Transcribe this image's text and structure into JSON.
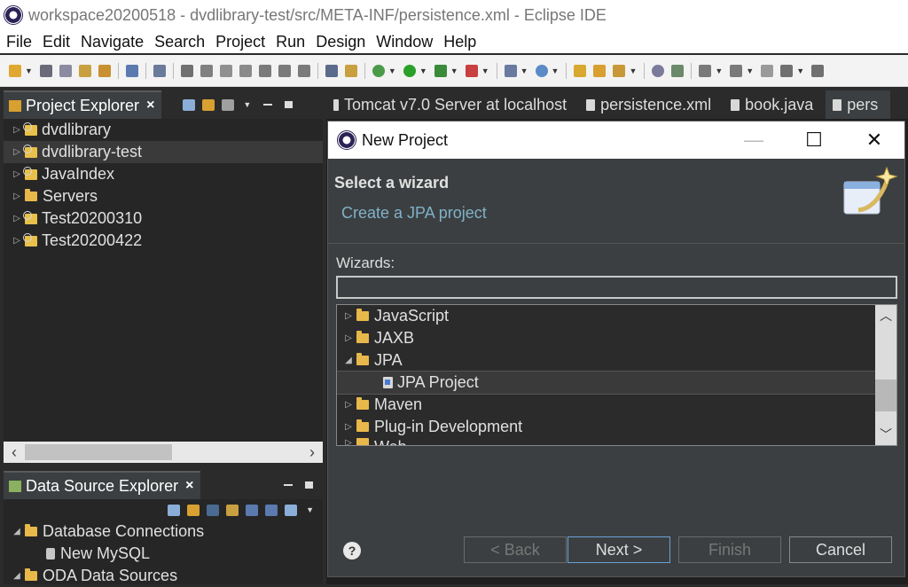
{
  "window": {
    "title": "workspace20200518 - dvdlibrary-test/src/META-INF/persistence.xml - Eclipse IDE",
    "icon": "eclipse-icon"
  },
  "menu": [
    "File",
    "Edit",
    "Navigate",
    "Search",
    "Project",
    "Run",
    "Design",
    "Window",
    "Help"
  ],
  "project_explorer": {
    "title": "Project Explorer",
    "close": "×",
    "items": [
      {
        "label": "dvdlibrary",
        "icon": "project-icon"
      },
      {
        "label": "dvdlibrary-test",
        "icon": "project-icon",
        "selected": true
      },
      {
        "label": "JavaIndex",
        "icon": "project-icon"
      },
      {
        "label": "Servers",
        "icon": "folder-icon"
      },
      {
        "label": "Test20200310",
        "icon": "project-icon"
      },
      {
        "label": "Test20200422",
        "icon": "project-icon"
      }
    ]
  },
  "data_source_explorer": {
    "title": "Data Source Explorer",
    "close": "×",
    "items": [
      {
        "label": "Database Connections",
        "expanded": true
      },
      {
        "label": "New MySQL"
      },
      {
        "label": "ODA Data Sources",
        "expanded": true
      }
    ]
  },
  "editor_tabs": [
    {
      "label": "Tomcat v7.0 Server at localhost"
    },
    {
      "label": "persistence.xml"
    },
    {
      "label": "book.java"
    },
    {
      "label": "pers"
    }
  ],
  "dialog": {
    "title": "New Project",
    "minimize": "—",
    "maximize": "☐",
    "close": "✕",
    "banner_title": "Select a wizard",
    "banner_desc": "Create a JPA project",
    "wizards_label": "Wizards:",
    "filter_value": "",
    "tree": [
      {
        "label": "JavaScript",
        "twisty": "▷"
      },
      {
        "label": "JAXB",
        "twisty": "▷"
      },
      {
        "label": "JPA",
        "twisty": "◢",
        "expanded": true
      },
      {
        "label": "JPA Project",
        "child": true,
        "selected": true
      },
      {
        "label": "Maven",
        "twisty": "▷"
      },
      {
        "label": "Plug-in Development",
        "twisty": "▷"
      },
      {
        "label": "Web",
        "twisty": "▷"
      }
    ],
    "buttons": {
      "back": "< Back",
      "next": "Next >",
      "finish": "Finish",
      "cancel": "Cancel",
      "help": "?"
    }
  }
}
